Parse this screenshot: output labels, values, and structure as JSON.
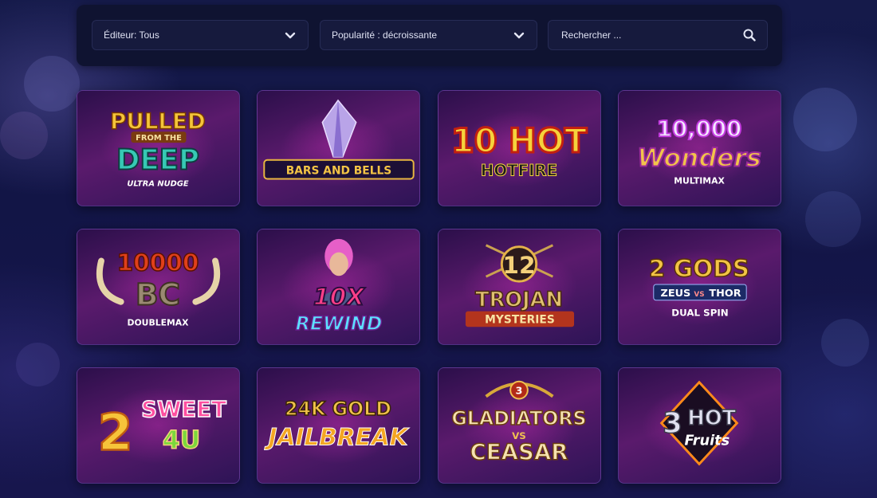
{
  "filters": {
    "publisher_label": "Éditeur: Tous",
    "popularity_label": "Popularité : décroissante",
    "search_placeholder": "Rechercher ..."
  },
  "games": [
    {
      "name": "Pulled from the Deep",
      "line1": "PULLED",
      "line2": "FROM THE",
      "line3": "DEEP",
      "line4": "ULTRA NUDGE"
    },
    {
      "name": "Bars and Bells",
      "line1": "BARS AND BELLS"
    },
    {
      "name": "10 Hot Hotfire",
      "line1": "10 HOT",
      "line2": "HOTFIRE"
    },
    {
      "name": "10,000 Wonders Multimax",
      "line1": "10,000",
      "line2": "Wonders",
      "line3": "MULTIMAX"
    },
    {
      "name": "10000 BC Doublemax",
      "line1": "10000",
      "line2": "BC",
      "line3": "DOUBLEMAX"
    },
    {
      "name": "10X Rewind",
      "line1": "10X",
      "line2": "REWIND"
    },
    {
      "name": "12 Trojan Mysteries",
      "line1": "12",
      "line2": "TROJAN",
      "line3": "MYSTERIES"
    },
    {
      "name": "2 Gods Zeus vs Thor",
      "line1": "2 GODS",
      "line2": "ZEUS",
      "line3": "VS",
      "line4": "THOR",
      "line5": "DUAL SPIN"
    },
    {
      "name": "2 Sweet 4U",
      "line1": "2",
      "line2": "SWEET",
      "line3": "4U"
    },
    {
      "name": "24K Gold Jailbreak",
      "line1": "24K GOLD",
      "line2": "JAILBREAK"
    },
    {
      "name": "3 Gladiators vs Ceasar",
      "line1": "3",
      "line2": "GLADIATORS",
      "line3": "VS",
      "line4": "CEASAR"
    },
    {
      "name": "3 Hot Fruits",
      "line1": "3",
      "line2": "HOT",
      "line3": "Fruits"
    }
  ],
  "icons": {
    "publisher_chevron": "chevron-down-icon",
    "popularity_chevron": "chevron-down-icon",
    "search": "search-icon"
  }
}
